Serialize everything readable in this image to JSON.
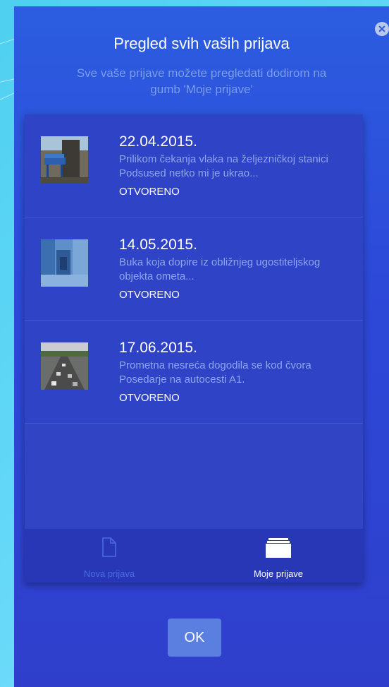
{
  "dialog": {
    "title": "Pregled svih vaših prijava",
    "subtitle": "Sve vaše prijave možete pregledati dodirom na gumb 'Moje prijave'",
    "close_icon": "close-icon",
    "ok_label": "OK"
  },
  "reports": [
    {
      "date": "22.04.2015.",
      "description": "Prilikom čekanja vlaka na željezničkoj stanici Podsused netko mi je ukrao...",
      "status": "OTVORENO"
    },
    {
      "date": "14.05.2015.",
      "description": "Buka koja dopire iz obližnjeg ugostiteljskog objekta ometa...",
      "status": "OTVORENO"
    },
    {
      "date": "17.06.2015.",
      "description": "Prometna nesreća dogodila se kod čvora Posedarje na autocesti A1.",
      "status": "OTVORENO"
    }
  ],
  "tabs": [
    {
      "label": "Nova prijava",
      "icon": "document-icon",
      "active": false
    },
    {
      "label": "Moje prijave",
      "icon": "stack-icon",
      "active": true
    }
  ],
  "colors": {
    "panel": "#2d49d8",
    "card": "#3044c4",
    "tabbar": "#2737b5",
    "inactive_tab": "#4a6be2",
    "ok_button": "#5a7fe0"
  }
}
